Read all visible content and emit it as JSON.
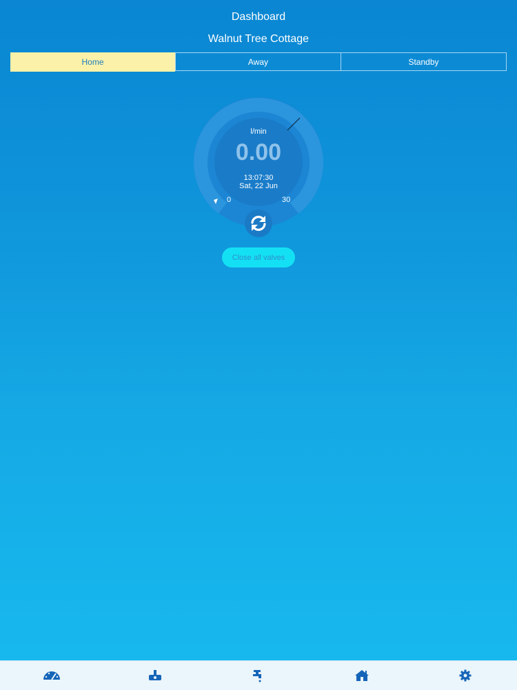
{
  "header": {
    "title": "Dashboard",
    "subtitle": "Walnut Tree Cottage"
  },
  "modes": {
    "items": [
      {
        "label": "Home",
        "active": true
      },
      {
        "label": "Away",
        "active": false
      },
      {
        "label": "Standby",
        "active": false
      }
    ]
  },
  "gauge": {
    "unit": "l/min",
    "value": "0.00",
    "time": "13:07:30",
    "date": "Sat, 22 Jun",
    "min_label": "0",
    "max_label": "30"
  },
  "actions": {
    "refresh_icon": "refresh-icon",
    "close_valves_label": "Close all valves"
  },
  "tabbar": {
    "items": [
      {
        "icon": "gauge-icon"
      },
      {
        "icon": "valve-icon"
      },
      {
        "icon": "tap-icon"
      },
      {
        "icon": "house-icon"
      },
      {
        "icon": "gear-icon"
      }
    ]
  },
  "colors": {
    "active_tab": "#fbf1a8",
    "accent": "#14e0f4",
    "icon_blue": "#1565b8"
  }
}
